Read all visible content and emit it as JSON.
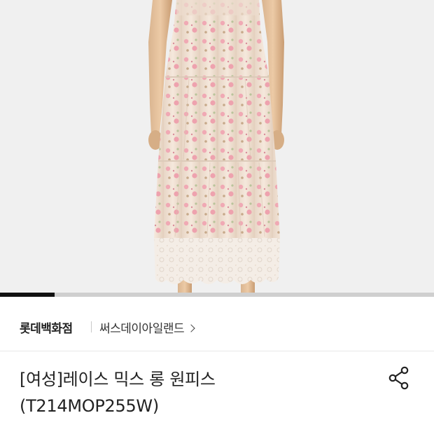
{
  "product": {
    "image_alt": "",
    "gallery_progress": 0.125
  },
  "store": {
    "name": "롯데백화점",
    "brand": "써스데이아일랜드"
  },
  "title": {
    "line1": "[여성]레이스 믹스 롱 원피스",
    "line2": "(T214MOP255W)"
  },
  "icons": {
    "brand_chevron": "chevron-right-icon",
    "share": "share-icon"
  },
  "colors": {
    "hero_background": "#f0f0f0",
    "progress_track": "#cfcfcf",
    "progress_fill": "#111111",
    "text_primary": "#222222"
  }
}
